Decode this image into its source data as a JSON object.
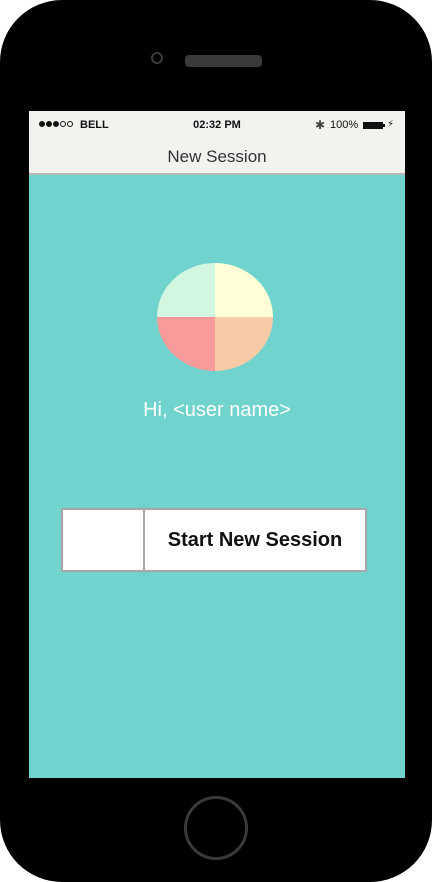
{
  "status_bar": {
    "carrier": "BELL",
    "time": "02:32 PM",
    "battery_percent": "100%",
    "signal_bars_filled": 3,
    "signal_bars_total": 5,
    "bluetooth_icon": "✱",
    "charge_icon": "⚡"
  },
  "nav_bar": {
    "title": "New Session"
  },
  "main": {
    "greeting": "Hi, <user name>",
    "start_button_label": "Start New Session"
  },
  "colors": {
    "screen_background": "#71d3ce",
    "bar_background": "#f3f2ee",
    "logo_top_left": "#d3f6e0",
    "logo_top_right": "#ffffd8",
    "logo_bottom_left": "#f89b9b",
    "logo_bottom_right": "#f8caa6"
  }
}
